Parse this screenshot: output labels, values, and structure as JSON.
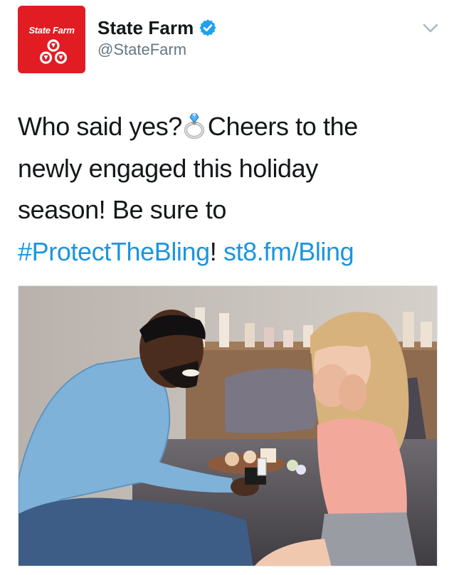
{
  "tweet": {
    "author": {
      "avatar_text": "State Farm",
      "display_name": "State Farm",
      "handle": "@StateFarm",
      "verified": true
    },
    "text_line1_a": "Who said yes?",
    "text_line1_b": "Cheers to the",
    "emoji_icon": "ring-emoji-icon",
    "text_line2": "newly engaged this holiday",
    "text_line3": "season! Be sure to",
    "hashtag": "#ProtectTheBling",
    "after_hashtag": "!",
    "link": "st8.fm/Bling",
    "photo_icon": "proposal-photo"
  },
  "colors": {
    "brand_red": "#e11c22",
    "link_blue": "#1b95e0",
    "verified_blue": "#1da1f2",
    "handle_gray": "#657786"
  }
}
